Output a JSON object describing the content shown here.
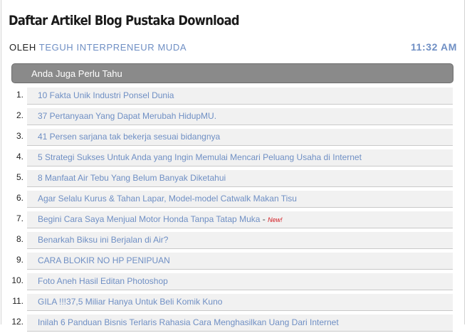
{
  "page": {
    "title": "Daftar Artikel Blog Pustaka Download",
    "byline_prefix": "OLEH",
    "author": "TEGUH INTERPRENEUR MUDA",
    "time": "11:32 AM"
  },
  "section": {
    "header": "Anda Juga Perlu Tahu"
  },
  "articles": [
    {
      "num": "1.",
      "title": "10 Fakta Unik Industri Ponsel Dunia"
    },
    {
      "num": "2.",
      "title": "37 Pertanyaan Yang Dapat Merubah HidupMU."
    },
    {
      "num": "3.",
      "title": "41 Persen sarjana tak bekerja sesuai bidangnya"
    },
    {
      "num": "4.",
      "title": "5 Strategi Sukses Untuk Anda yang Ingin Memulai Mencari Peluang Usaha di Internet"
    },
    {
      "num": "5.",
      "title": "8 Manfaat Air Tebu Yang Belum Banyak Diketahui"
    },
    {
      "num": "6.",
      "title": "Agar Selalu Kurus & Tahan Lapar, Model-model Catwalk Makan Tisu"
    },
    {
      "num": "7.",
      "title": "Begini Cara Saya Menjual Motor Honda Tanpa Tatap Muka",
      "separator": " - ",
      "badge": "New!"
    },
    {
      "num": "8.",
      "title": "Benarkah Biksu ini Berjalan di Air?"
    },
    {
      "num": "9.",
      "title": "CARA BLOKIR NO HP PENIPUAN"
    },
    {
      "num": "10.",
      "title": "Foto Aneh Hasil Editan Photoshop"
    },
    {
      "num": "11.",
      "title": "GILA !!!37,5 Miliar Hanya Untuk Beli Komik Kuno"
    },
    {
      "num": "12.",
      "title": "Inilah 6 Panduan Bisnis Terlaris Rahasia Cara Menghasilkan Uang Dari Internet"
    }
  ]
}
